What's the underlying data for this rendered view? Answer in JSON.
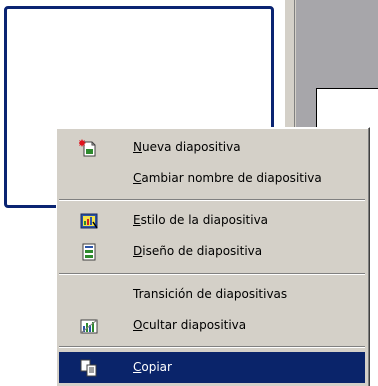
{
  "menu": {
    "items": [
      {
        "mnemonic": "N",
        "rest": "ueva diapositiva",
        "icon": "new-slide-icon"
      },
      {
        "mnemonic": "C",
        "rest": "ambiar nombre de diapositiva",
        "icon": ""
      },
      {
        "mnemonic": "E",
        "rest": "stilo de la diapositiva",
        "icon": "slide-style-icon"
      },
      {
        "mnemonic": "D",
        "rest": "iseño de diapositiva",
        "icon": "slide-layout-icon"
      },
      {
        "label": "Transición de diapositivas",
        "icon": ""
      },
      {
        "mnemonic": "O",
        "rest": "cultar diapositiva",
        "icon": "hide-slide-icon"
      },
      {
        "mnemonic": "C",
        "rest": "opiar",
        "icon": "copy-icon"
      }
    ]
  },
  "colors": {
    "menu_bg": "#d4d0c8",
    "highlight": "#0a246a",
    "selection_border": "#0a2472"
  }
}
